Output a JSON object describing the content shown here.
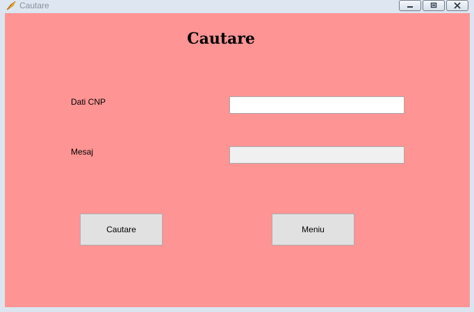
{
  "window": {
    "title": "Cautare",
    "icon": "app-feather-icon",
    "controls": {
      "minimize": "minimize-icon",
      "maximize": "restore-icon",
      "close": "close-icon"
    }
  },
  "form": {
    "heading": "Cautare",
    "cnp_label": "Dati CNP",
    "cnp_value": "",
    "message_label": "Mesaj",
    "message_value": "",
    "search_button": "Cautare",
    "menu_button": "Meniu"
  },
  "colors": {
    "background": "#ff9494",
    "button": "#e1e1e1",
    "readonly_field": "#f0f0f0"
  }
}
